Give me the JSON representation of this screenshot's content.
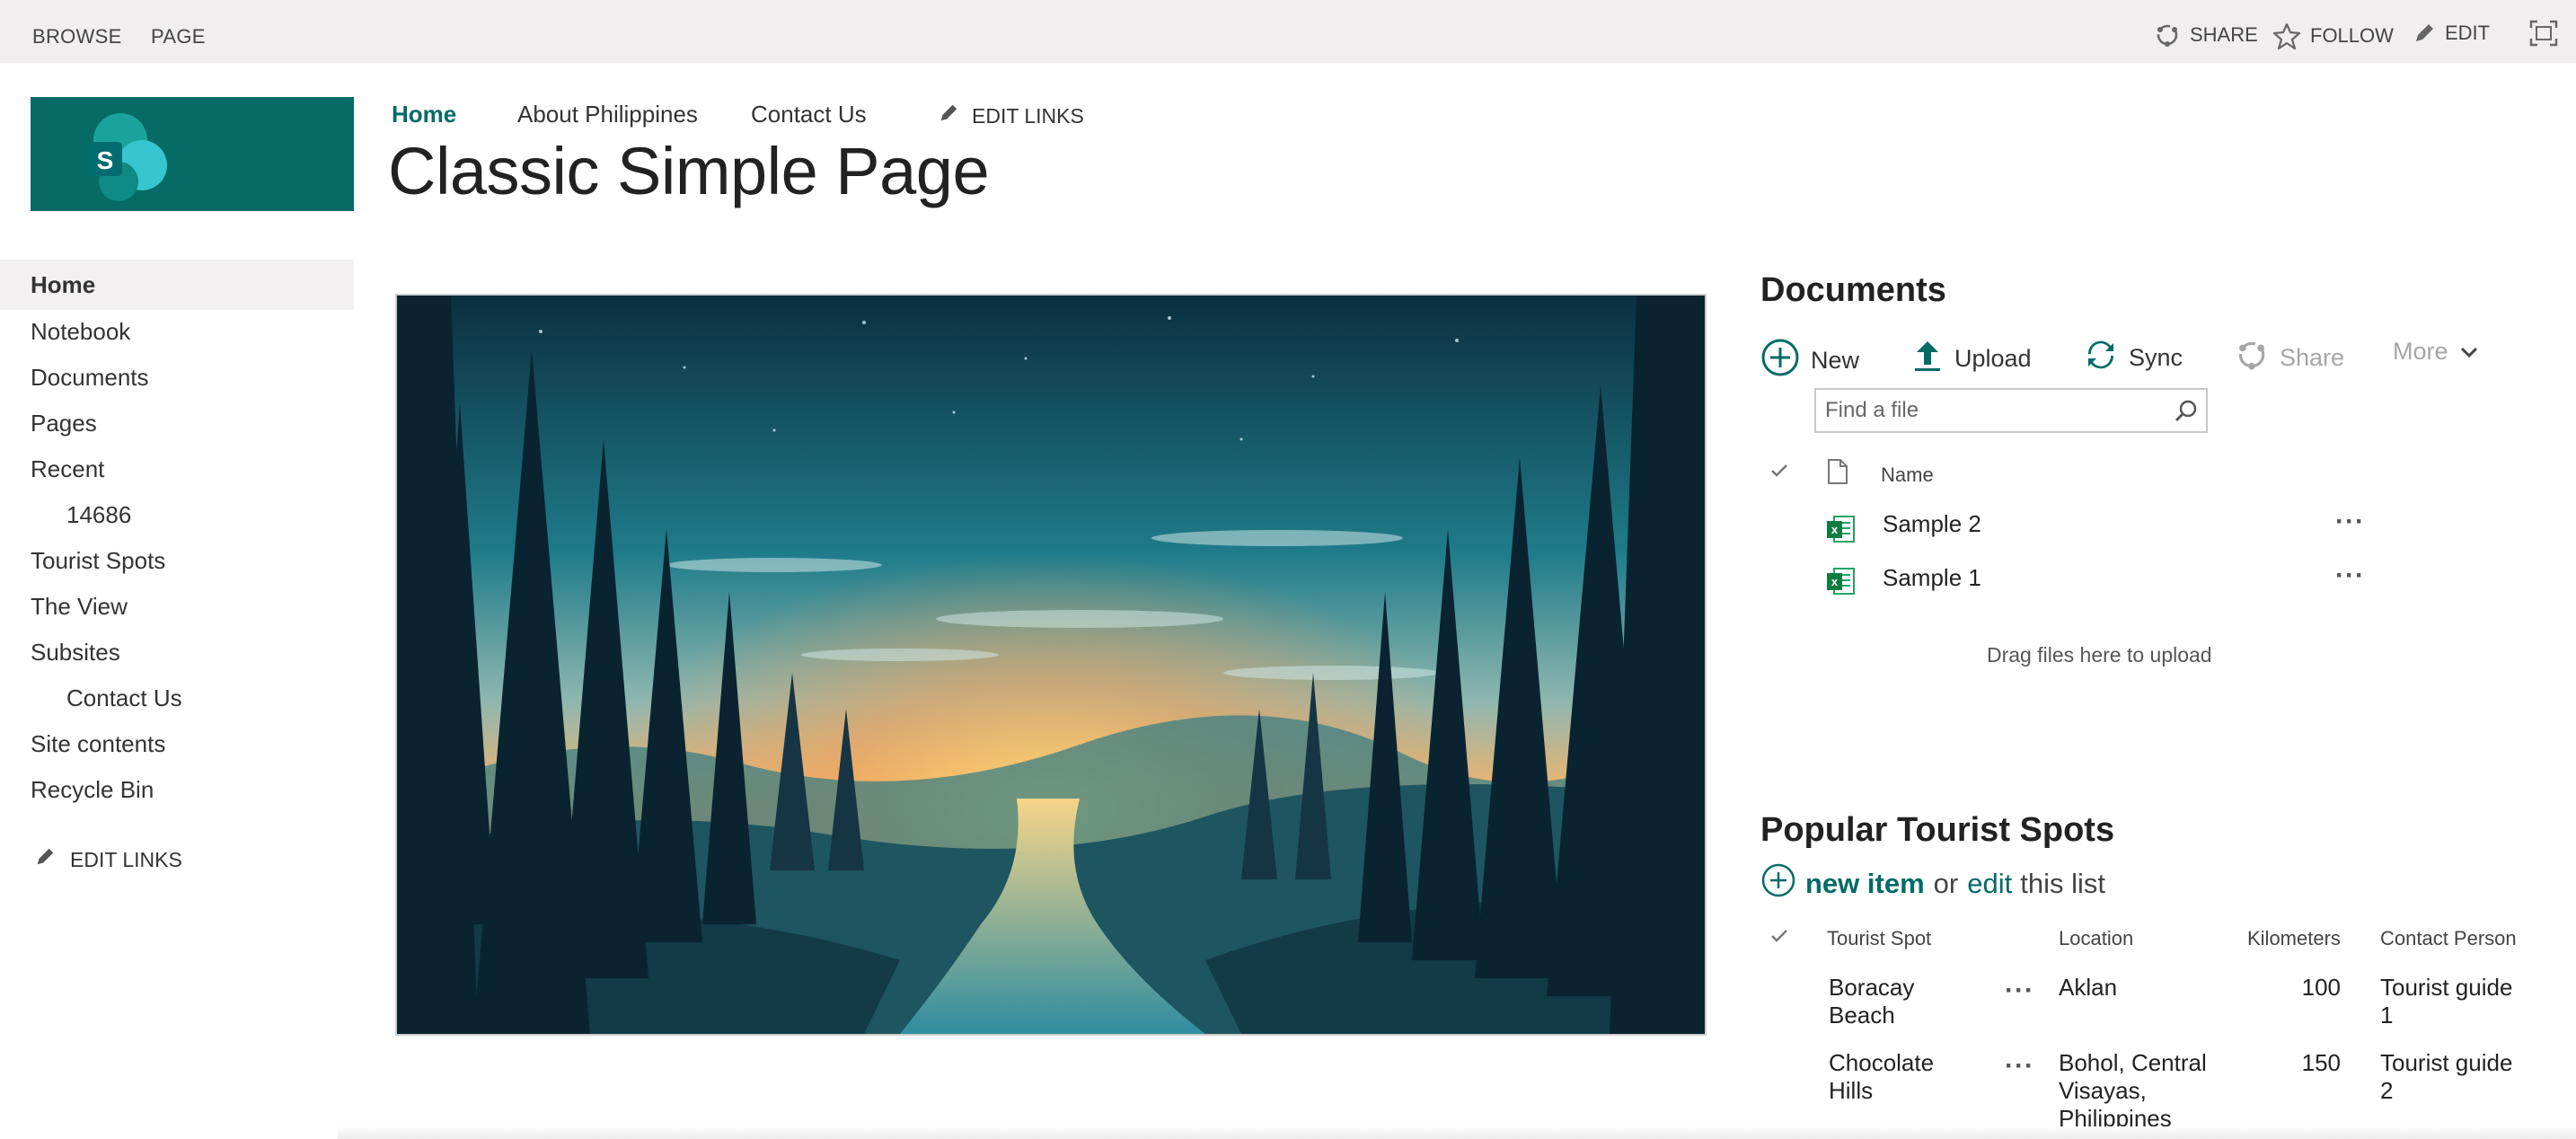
{
  "suitebar": {
    "tabs": [
      "BROWSE",
      "PAGE"
    ],
    "actions": {
      "share": "SHARE",
      "follow": "FOLLOW",
      "edit": "EDIT"
    }
  },
  "topnav": {
    "items": [
      "Home",
      "About Philippines",
      "Contact Us"
    ],
    "edit_links": "EDIT LINKS"
  },
  "page_title": "Classic Simple Page",
  "leftnav": {
    "items": [
      "Home",
      "Notebook",
      "Documents",
      "Pages",
      "Recent",
      "14686",
      "Tourist Spots",
      "The View",
      "Subsites",
      "Contact Us",
      "Site contents",
      "Recycle Bin"
    ],
    "edit_links": "EDIT LINKS"
  },
  "documents": {
    "title": "Documents",
    "commands": {
      "new": "New",
      "upload": "Upload",
      "sync": "Sync",
      "share": "Share",
      "more": "More"
    },
    "search_placeholder": "Find a file",
    "column_name": "Name",
    "files": [
      "Sample 2",
      "Sample 1"
    ],
    "drag_text": "Drag files here to upload"
  },
  "tourist_list": {
    "title": "Popular Tourist Spots",
    "new_item": "new item",
    "or_text": "or",
    "edit_text": "edit",
    "this_list": "this list",
    "columns": [
      "Tourist Spot",
      "Location",
      "Kilometers",
      "Contact Person"
    ],
    "rows": [
      {
        "spot": [
          "Boracay",
          "Beach"
        ],
        "location": [
          "Aklan"
        ],
        "km": "100",
        "contact": [
          "Tourist guide",
          "1"
        ]
      },
      {
        "spot": [
          "Chocolate",
          "Hills"
        ],
        "location": [
          "Bohol, Central",
          "Visayas,",
          "Philippines"
        ],
        "km": "150",
        "contact": [
          "Tourist guide",
          "2"
        ]
      }
    ]
  },
  "colors": {
    "accent": "#036b66",
    "logo_bg": "#056b64",
    "suitebar_bg": "#f0eeee"
  }
}
